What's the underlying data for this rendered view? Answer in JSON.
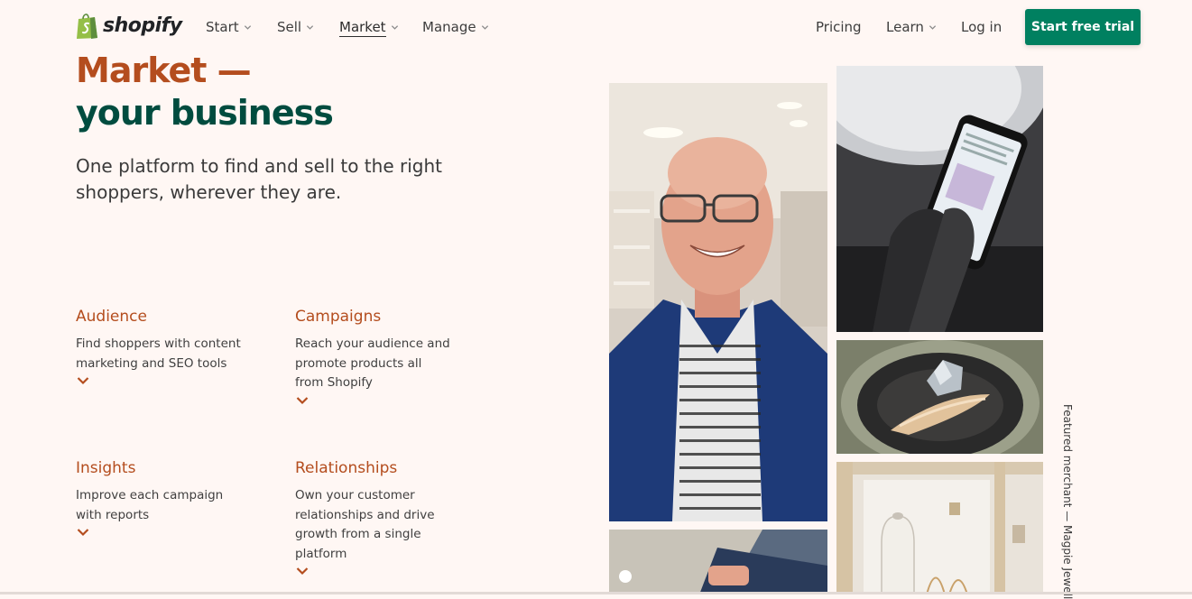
{
  "brand": {
    "name": "shopify"
  },
  "nav": {
    "items": [
      {
        "label": "Start",
        "has_dropdown": true
      },
      {
        "label": "Sell",
        "has_dropdown": true
      },
      {
        "label": "Market",
        "has_dropdown": true,
        "active": true
      },
      {
        "label": "Manage",
        "has_dropdown": true
      }
    ],
    "right": {
      "pricing": "Pricing",
      "learn": "Learn",
      "login": "Log in",
      "cta": "Start free trial"
    }
  },
  "hero": {
    "line1": "Market —",
    "line2": "your business",
    "subtitle": "One platform to find and sell to the right shoppers, wherever they are."
  },
  "features": [
    {
      "title": "Audience",
      "description": "Find shoppers with content marketing and SEO tools"
    },
    {
      "title": "Campaigns",
      "description": "Reach your audience and promote products all from Shopify"
    },
    {
      "title": "Insights",
      "description": "Improve each campaign with reports"
    },
    {
      "title": "Relationships",
      "description": "Own your customer relationships and drive growth from a single platform"
    }
  ],
  "featured_caption": "Featured merchant — Magpie Jewell",
  "colors": {
    "accent": "#008060",
    "orange": "#b44d1e",
    "dark_green": "#004c3f",
    "background": "#fff7f4"
  }
}
